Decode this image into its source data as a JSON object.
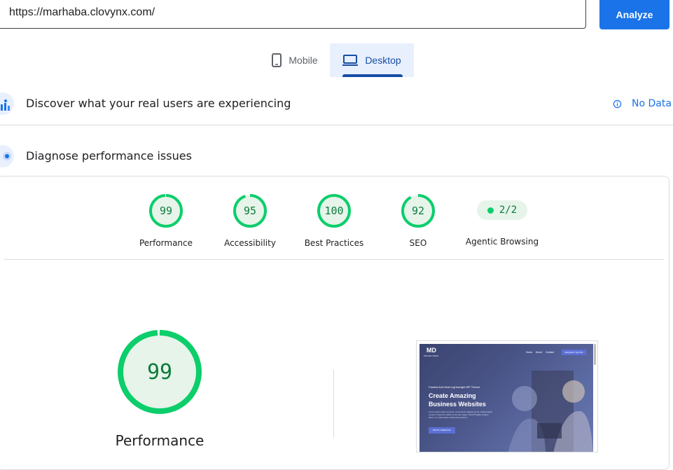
{
  "url_bar": {
    "value": "https://marhaba.clovynx.com/",
    "analyze_label": "Analyze"
  },
  "tabs": [
    {
      "label": "Mobile",
      "icon": "smartphone-icon",
      "selected": false
    },
    {
      "label": "Desktop",
      "icon": "laptop-icon",
      "selected": true
    }
  ],
  "field_data": {
    "title": "Discover what your real users are experiencing",
    "status": "No Data",
    "icon": "field-data-icon"
  },
  "diagnose": {
    "title": "Diagnose performance issues",
    "icon": "lighthouse-icon"
  },
  "scores": [
    {
      "value": "99",
      "label": "Performance",
      "fraction": 0.99
    },
    {
      "value": "95",
      "label": "Accessibility",
      "fraction": 0.95
    },
    {
      "value": "100",
      "label": "Best Practices",
      "fraction": 1.0
    },
    {
      "value": "92",
      "label": "SEO",
      "fraction": 0.92
    }
  ],
  "agentic": {
    "value": "2/2",
    "label": "Agentic Browsing"
  },
  "main_score": {
    "value": "99",
    "label": "Performance",
    "fraction": 0.99
  },
  "screenshot": {
    "logo": "MD",
    "logo_sub": "Marhaba Digital",
    "nav": [
      "Home",
      "About",
      "Contact"
    ],
    "cta": "REQUEST QUOTE",
    "eyebrow": "Fastest And Most Lightweight WP Theme",
    "headline": "Create Amazing Business Websites",
    "body": "Lorem ipsum dolor sit amet, consectetur adipiscing elit. Suspendisse et justo. Praesent mattis commodo augue. Morbi fringilla congue libero, eu malesuada malesuada eleifend.",
    "button": "BOOK A MEETING"
  },
  "colors": {
    "accent": "#1a73e8",
    "pass": "#0cce6b",
    "pass_text": "#0c7c3a",
    "pass_bg": "#e6f4ea"
  }
}
